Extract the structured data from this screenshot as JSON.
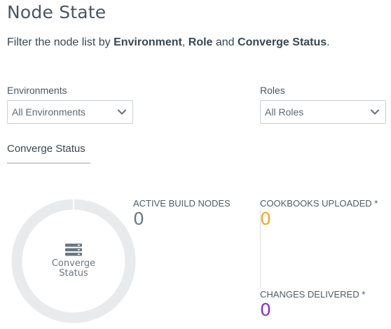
{
  "page": {
    "title": "Node State",
    "subtitle": {
      "prefix": "Filter the node list by ",
      "env": "Environment",
      "sep1": ", ",
      "role": "Role",
      "sep2": " and ",
      "status": "Converge Status",
      "suffix": "."
    }
  },
  "filters": {
    "environments": {
      "label": "Environments",
      "value": "All Environments"
    },
    "roles": {
      "label": "Roles",
      "value": "All Roles"
    }
  },
  "tabs": [
    {
      "label": "Converge Status"
    }
  ],
  "donut": {
    "icon": "server-stack-icon",
    "label_line1": "Converge",
    "label_line2": "Status",
    "ring_color": "#e8eaec"
  },
  "stats": {
    "active_build_nodes": {
      "label": "ACTIVE BUILD NODES",
      "value": "0",
      "color": "#6c7b8a"
    },
    "cookbooks_uploaded": {
      "label": "COOKBOOKS UPLOADED *",
      "value": "0",
      "color": "#f5a623"
    },
    "changes_delivered": {
      "label": "CHANGES DELIVERED *",
      "value": "0",
      "color": "#8a2be2"
    }
  }
}
